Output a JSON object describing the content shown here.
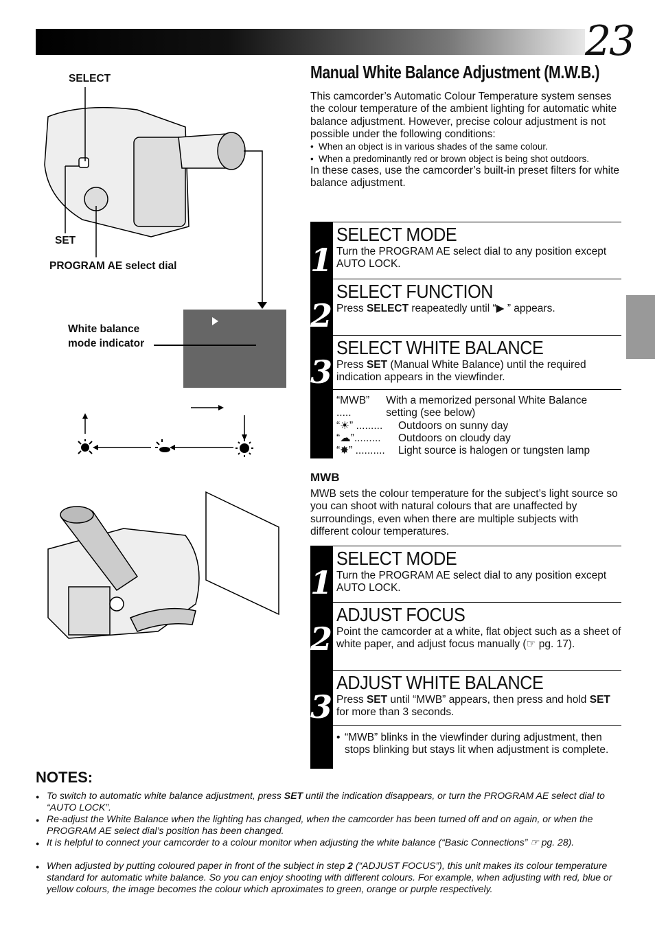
{
  "page_number": "23",
  "title": "Manual White Balance Adjustment (M.W.B.)",
  "intro": {
    "para1": "This camcorder’s Automatic Colour Temperature system senses the colour temperature of the ambient lighting for automatic white balance adjustment. However, precise colour adjustment is not possible under the following conditions:",
    "bullets": [
      "When an object is in various shades of the same colour.",
      "When a predominantly red or brown object is being shot outdoors."
    ],
    "para2": "In these cases, use the camcorder’s built-in preset filters for white balance adjustment."
  },
  "figure": {
    "labels": {
      "select": "SELECT",
      "set": "SET",
      "program_ae": "PROGRAM AE select dial",
      "wb_indicator_line1": "White balance",
      "wb_indicator_line2": "mode indicator"
    },
    "icons": [
      "halogen-icon",
      "cloudy-icon",
      "sunny-icon"
    ],
    "viewfinder_color": "#666666"
  },
  "group1": {
    "steps": [
      {
        "num": "1",
        "title": "SELECT MODE",
        "body": "Turn the PROGRAM AE select dial to any position except AUTO LOCK."
      },
      {
        "num": "2",
        "title": "SELECT FUNCTION",
        "body_pre": "Press ",
        "body_bold": "SELECT",
        "body_post": " reapeatedly until “▶             ” appears."
      },
      {
        "num": "3",
        "title": "SELECT WHITE BALANCE",
        "body_pre": "Press ",
        "body_bold": "SET",
        "body_post": " (Manual White Balance) until the required indication appears in the viewfinder."
      }
    ],
    "modes": [
      {
        "key": "“MWB” .....",
        "desc": "With a memorized personal White Balance setting (see below)"
      },
      {
        "key": "“☀” .........",
        "desc": "Outdoors on sunny day",
        "icon": "sunny-icon"
      },
      {
        "key": "“☁”.........",
        "desc": "Outdoors on cloudy day",
        "icon": "cloudy-icon"
      },
      {
        "key": "“✸” ..........",
        "desc": "Light source is halogen or tungsten lamp",
        "icon": "halogen-icon"
      }
    ]
  },
  "mwb": {
    "heading": "MWB",
    "body": "MWB sets the colour temperature for the subject’s light source so you can shoot with natural colours that are unaffected by surroundings, even when there are multiple subjects with different colour temperatures."
  },
  "group2": {
    "steps": [
      {
        "num": "1",
        "title": "SELECT MODE",
        "body": "Turn the PROGRAM AE select dial to any position except AUTO LOCK."
      },
      {
        "num": "2",
        "title": "ADJUST FOCUS",
        "body": "Point the camcorder at a white, flat object such as a sheet of white paper, and adjust focus manually (☞ pg. 17)."
      },
      {
        "num": "3",
        "title": "ADJUST WHITE BALANCE",
        "b1": "Press ",
        "b2": "SET",
        "b3": " until “MWB” appears, then press and hold ",
        "b4": "SET",
        "b5": " for more than 3 seconds."
      }
    ],
    "note": "“MWB” blinks in the viewfinder during adjustment, then stops blinking but stays lit when adjustment is complete."
  },
  "notes": {
    "heading": "NOTES:",
    "items": [
      {
        "a": "To switch to automatic white balance adjustment, press ",
        "b": "SET",
        "c": " until the indication disappears, or turn the PROGRAM AE select dial to “AUTO LOCK”."
      },
      {
        "a": "Re-adjust the White Balance when the lighting has changed, when the camcorder has been turned off and on again, or when the PROGRAM AE select dial’s position has been changed.",
        "b": "",
        "c": ""
      },
      {
        "a": "It is helpful to connect your camcorder to a colour monitor when adjusting the white balance (“Basic Connections” ☞ pg. 28).",
        "b": "",
        "c": ""
      },
      {
        "a": "When adjusted by putting coloured paper in front of the subject in step ",
        "b": "2",
        "c": " (“ADJUST FOCUS”), this unit makes its colour temperature standard for automatic white balance. So you can enjoy shooting with different colours. For example, when adjusting with red, blue or yellow colours, the image becomes the colour which aproximates to green, orange or purple respectively."
      }
    ]
  }
}
